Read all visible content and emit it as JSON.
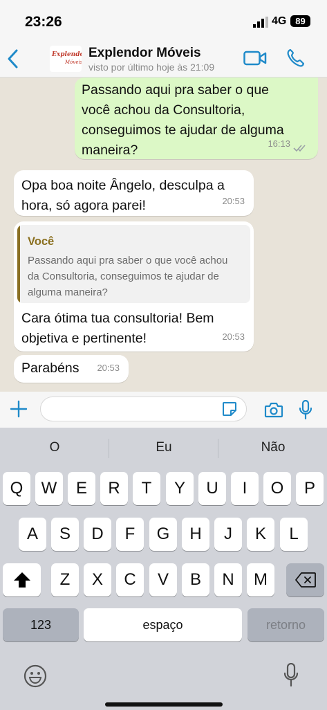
{
  "status_bar": {
    "time": "23:26",
    "network": "4G",
    "battery": "89"
  },
  "header": {
    "avatar_logo_line1": "Explendor",
    "avatar_logo_line2": "Móveis",
    "contact_name": "Explendor Móveis",
    "last_seen": "visto por último hoje às 21:09"
  },
  "messages": [
    {
      "direction": "outgoing",
      "lines": [
        "Passando aqui pra saber o que",
        "você achou da Consultoria,",
        "conseguimos te ajudar de alguma",
        "maneira?"
      ],
      "time": "16:13",
      "read_ticks_icon": "double-check-icon"
    },
    {
      "direction": "incoming",
      "lines": [
        "Opa boa noite Ângelo, desculpa a",
        "hora, só agora parei!"
      ],
      "time": "20:53"
    },
    {
      "direction": "incoming",
      "reply_to": {
        "author": "Você",
        "lines": [
          "Passando aqui pra saber o que você achou",
          "da Consultoria, conseguimos te ajudar de",
          "alguma maneira?"
        ]
      },
      "lines": [
        "Cara ótima tua consultoria! Bem",
        "objetiva e pertinente!"
      ],
      "time": "20:53"
    },
    {
      "direction": "incoming",
      "lines": [
        "Parabéns"
      ],
      "time": "20:53"
    }
  ],
  "input_bar": {
    "placeholder": ""
  },
  "keyboard": {
    "suggestions": [
      "O",
      "Eu",
      "Não"
    ],
    "row1": [
      "Q",
      "W",
      "E",
      "R",
      "T",
      "Y",
      "U",
      "I",
      "O",
      "P"
    ],
    "row2": [
      "A",
      "S",
      "D",
      "F",
      "G",
      "H",
      "J",
      "K",
      "L"
    ],
    "row3": [
      "Z",
      "X",
      "C",
      "V",
      "B",
      "N",
      "M"
    ],
    "numbers_key": "123",
    "space_key": "espaço",
    "return_key": "retorno"
  },
  "colors": {
    "accent": "#1f8ac9",
    "outgoing_bubble": "#dcf8c6",
    "incoming_bubble": "#ffffff",
    "quote_author": "#8a6f1e"
  }
}
